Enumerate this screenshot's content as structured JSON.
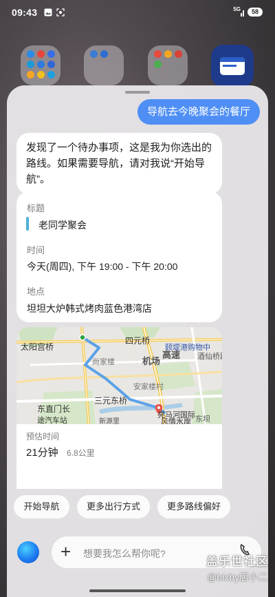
{
  "status_bar": {
    "time": "09:43",
    "signal": "5G",
    "battery": "58"
  },
  "home": {
    "folder_icons": [
      "folder-1",
      "folder-2",
      "folder-3",
      "news-app"
    ]
  },
  "chat": {
    "user_message": "导航去今晚聚会的餐厅",
    "bot_message": "发现了一个待办事项，这是我为你选出的路线。如果需要导航，请对我说“开始导航”。"
  },
  "event_card": {
    "title_label": "标题",
    "title_value": "老同学聚会",
    "time_label": "时间",
    "time_value": "今天(周四), 下午 19:00 - 下午 20:00",
    "location_label": "地点",
    "location_value": "坦坦大炉韩式烤肉蓝色港湾店"
  },
  "map": {
    "places": {
      "taiyanggong": "太阳宫桥",
      "siyuan": "四元桥",
      "yiti": "颐堤港购物中",
      "shangjialou": "尚家楼",
      "anjialou": "安家楼村",
      "sanyuan": "三元东桥",
      "liangma": "亮马河国际",
      "fengqing": "风情水岸",
      "dongzhimen": "东直门长",
      "xinyuanli": "新源里",
      "qichezhan": "途汽车站",
      "jichang": "机场",
      "gaosu": "高速",
      "jinxian": "酒仙桥路",
      "dongba": "东坝"
    },
    "eta_label": "预估时间",
    "eta_time": "21分钟",
    "eta_distance": "6.8公里"
  },
  "chips": [
    "开始导航",
    "更多出行方式",
    "更多路线偏好"
  ],
  "input": {
    "placeholder": "想要我怎么帮你呢?"
  },
  "watermark": {
    "line1": "盖乐世社区",
    "line2": "@bixby店小二"
  },
  "colors": {
    "user_bubble": "#4f8ff5",
    "route": "#5aa2e8",
    "destination_pin": "#e8534a",
    "title_accent": "#4fb0d8"
  }
}
